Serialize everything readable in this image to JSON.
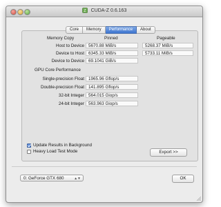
{
  "window": {
    "title": "CUDA-Z 0.6.163"
  },
  "tabs": [
    {
      "label": "Core"
    },
    {
      "label": "Memory"
    },
    {
      "label": "Performance",
      "active": true
    },
    {
      "label": "About"
    }
  ],
  "performance": {
    "memory_copy_label": "Memory Copy",
    "pinned_header": "Pinned",
    "pageable_header": "Pageable",
    "rows": [
      {
        "label": "Host to Device",
        "pinned": "5670.88 MiB/s",
        "pageable": "5268.37 MiB/s"
      },
      {
        "label": "Device to Host",
        "pinned": "6345.33 MiB/s",
        "pageable": "5733.11 MiB/s"
      },
      {
        "label": "Device to Device",
        "pinned": "69.1041 GiB/s"
      }
    ],
    "core_label": "GPU Core Performance",
    "core_rows": [
      {
        "label": "Single-precision Float",
        "value": "1965.96 Gflop/s"
      },
      {
        "label": "Double-precision Float",
        "value": "141.895 Gflop/s"
      },
      {
        "label": "32-bit Integer",
        "value": "564.015 Giop/s"
      },
      {
        "label": "24-bit Integer",
        "value": "563.963 Giop/s"
      }
    ]
  },
  "options": {
    "update_results": {
      "label": "Update Results in Background",
      "checked": true
    },
    "heavy_load": {
      "label": "Heavy Load Test Mode",
      "checked": false
    }
  },
  "export_button": "Export >>",
  "device_select": {
    "value": "0: GeForce GTX 680"
  },
  "ok_button": "OK",
  "colors": {
    "tab_active": "#3d75d0",
    "window_bg": "#ececec"
  }
}
